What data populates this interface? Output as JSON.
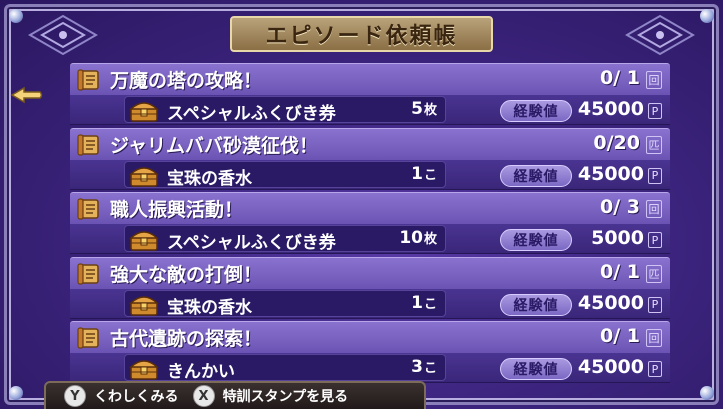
{
  "title": "エピソード依頼帳",
  "entries": [
    {
      "quest": "万魔の塔の攻略！",
      "progress": "0/ 1",
      "unit": "回",
      "reward": "スペシャルふくびき券",
      "qty": "5",
      "qty_unit": "枚",
      "exp_label": "経験値",
      "exp": "45000",
      "p": "P"
    },
    {
      "quest": "ジャリムババ砂漠征伐！",
      "progress": "0/20",
      "unit": "匹",
      "reward": "宝珠の香水",
      "qty": "1",
      "qty_unit": "こ",
      "exp_label": "経験値",
      "exp": "45000",
      "p": "P"
    },
    {
      "quest": "職人振興活動！",
      "progress": "0/ 3",
      "unit": "回",
      "reward": "スペシャルふくびき券",
      "qty": "10",
      "qty_unit": "枚",
      "exp_label": "経験値",
      "exp": "5000",
      "p": "P"
    },
    {
      "quest": "強大な敵の打倒！",
      "progress": "0/ 1",
      "unit": "匹",
      "reward": "宝珠の香水",
      "qty": "1",
      "qty_unit": "こ",
      "exp_label": "経験値",
      "exp": "45000",
      "p": "P"
    },
    {
      "quest": "古代遺跡の探索！",
      "progress": "0/ 1",
      "unit": "回",
      "reward": "きんかい",
      "qty": "3",
      "qty_unit": "こ",
      "exp_label": "経験値",
      "exp": "45000",
      "p": "P"
    }
  ],
  "footer": {
    "y_glyph": "Y",
    "y_label": "くわしくみる",
    "x_glyph": "X",
    "x_label": "特訓スタンプを見る"
  },
  "icons": {
    "cursor": "pointer-hand-icon",
    "scroll": "scroll-icon",
    "chest": "treasure-chest-icon"
  }
}
